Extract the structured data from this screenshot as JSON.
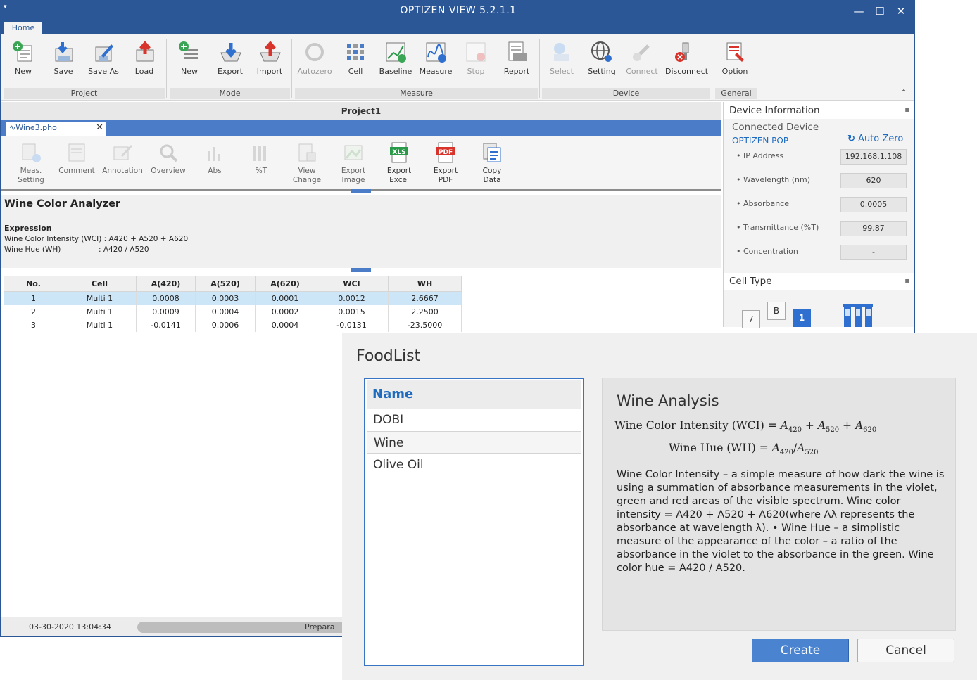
{
  "window": {
    "title": "OPTIZEN VIEW 5.2.1.1",
    "quick_access": "▾",
    "min": "—",
    "max": "☐",
    "close": "✕"
  },
  "ribbon": {
    "tab": "Home",
    "buttons": {
      "new_project": "New",
      "save": "Save",
      "save_as": "Save As",
      "load": "Load",
      "new_mode": "New",
      "export": "Export",
      "import": "Import",
      "autozero": "Autozero",
      "cell": "Cell",
      "baseline": "Baseline",
      "measure": "Measure",
      "stop": "Stop",
      "report": "Report",
      "select": "Select",
      "setting": "Setting",
      "connect": "Connect",
      "disconnect": "Disconnect",
      "option": "Option"
    },
    "groups": {
      "project": "Project",
      "mode": "Mode",
      "measure": "Measure",
      "device": "Device",
      "general": "General"
    },
    "collapse": "⌃"
  },
  "project_title": "Project1",
  "doc_tab": {
    "name": "Wine3.pho",
    "close": "✕"
  },
  "sub_ribbon": {
    "meas_setting_1": "Meas.",
    "meas_setting_2": "Setting",
    "comment": "Comment",
    "annotation": "Annotation",
    "overview": "Overview",
    "abs": "Abs",
    "pct_t": "%T",
    "view_change_1": "View",
    "view_change_2": "Change",
    "export_image_1": "Export",
    "export_image_2": "Image",
    "export_excel_1": "Export",
    "export_excel_2": "Excel",
    "export_pdf_1": "Export",
    "export_pdf_2": "PDF",
    "copy_data_1": "Copy",
    "copy_data_2": "Data"
  },
  "analyzer": {
    "title": "Wine Color Analyzer",
    "expression_label": "Expression",
    "line1": "Wine Color Intensity (WCI) : A420 + A520 + A620",
    "line2_label": "Wine Hue (WH)",
    "line2_expr": ": A420 / A520"
  },
  "grid": {
    "headers": [
      "No.",
      "Cell",
      "A(420)",
      "A(520)",
      "A(620)",
      "WCI",
      "WH"
    ],
    "rows": [
      [
        "1",
        "Multi 1",
        "0.0008",
        "0.0003",
        "0.0001",
        "0.0012",
        "2.6667"
      ],
      [
        "2",
        "Multi 1",
        "0.0009",
        "0.0004",
        "0.0002",
        "0.0015",
        "2.2500"
      ],
      [
        "3",
        "Multi 1",
        "-0.0141",
        "0.0006",
        "0.0004",
        "-0.0131",
        "-23.5000"
      ]
    ]
  },
  "status": {
    "date": "03-30-2020 13:04:34",
    "progress_text": "Prepara"
  },
  "device_panel": {
    "title": "Device Information",
    "connected_label": "Connected Device",
    "device_name": "OPTIZEN POP",
    "auto_zero": "Auto Zero",
    "ip_label": "• IP Address",
    "ip_value": "192.168.1.108",
    "wl_label": "• Wavelength (nm)",
    "wl_value": "620",
    "abs_label": "• Absorbance",
    "abs_value": "0.0005",
    "trans_label": "• Transmittance (%T)",
    "trans_value": "99.87",
    "conc_label": "• Concentration",
    "conc_value": "-",
    "pin": "📌"
  },
  "cell_type_panel": {
    "title": "Cell Type",
    "c7": "7",
    "cb": "B",
    "c1": "1"
  },
  "dialog": {
    "title": "FoodList",
    "list_header": "Name",
    "items": [
      "DOBI",
      "Wine",
      "Olive Oil"
    ],
    "detail_title": "Wine Analysis",
    "formula1_prefix": "Wine Color Intensity (WCI) = ",
    "formula2_prefix": "Wine Hue (WH) = ",
    "description": "Wine Color Intensity – a simple measure of how dark the wine is using a summation of absorbance measurements in the violet, green and red areas of the visible spectrum. Wine color intensity = A420 + A520 + A620(where Aλ represents the absorbance at wavelength λ). • Wine Hue – a simplistic measure of the appearance of the color – a ratio of the absorbance in the violet to the absorbance in the green. Wine color hue = A420 / A520.",
    "create": "Create",
    "cancel": "Cancel"
  },
  "colors": {
    "titlebar": "#2b5797",
    "accent": "#1e6bc0",
    "selection": "#cde6f7",
    "create_button": "#4a84d0"
  }
}
